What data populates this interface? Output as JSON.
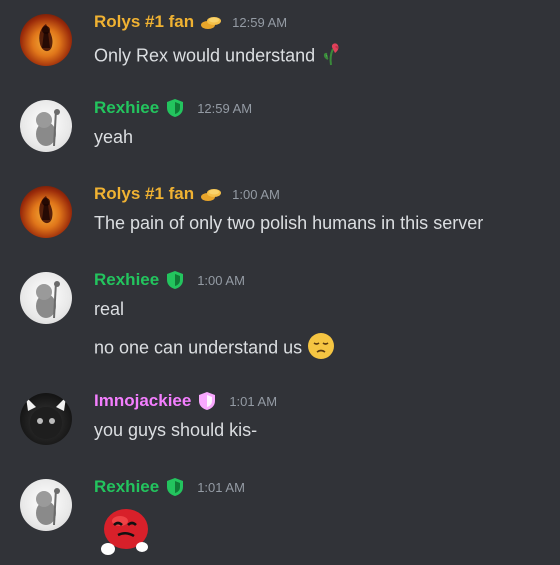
{
  "messages": [
    {
      "username": "Rolys #1 fan",
      "username_color": "#f0b232",
      "badge_icon": "gold-coins-icon",
      "time": "12:59 AM",
      "lines": [
        "Only Rex would understand"
      ],
      "line_emoji": "wilted-flower-icon"
    },
    {
      "username": "Rexhiee",
      "username_color": "#23c45e",
      "badge_icon": "green-shield-icon",
      "time": "12:59 AM",
      "lines": [
        "yeah"
      ]
    },
    {
      "username": "Rolys #1 fan",
      "username_color": "#f0b232",
      "badge_icon": "gold-coins-icon",
      "time": "1:00 AM",
      "lines": [
        "The pain of only two polish humans in this server"
      ]
    },
    {
      "username": "Rexhiee",
      "username_color": "#23c45e",
      "badge_icon": "green-shield-icon",
      "time": "1:00 AM",
      "lines": [
        "real",
        "no one can understand us"
      ],
      "line_emoji": "pensive-face-icon"
    },
    {
      "username": "Imnojackiee",
      "username_color": "#f47fff",
      "badge_icon": "pink-shield-icon",
      "time": "1:01 AM",
      "lines": [
        "you guys should kis-"
      ]
    },
    {
      "username": "Rexhiee",
      "username_color": "#23c45e",
      "badge_icon": "green-shield-icon",
      "time": "1:01 AM",
      "lines": [],
      "sticker": "red-candy-character-sticker"
    }
  ]
}
